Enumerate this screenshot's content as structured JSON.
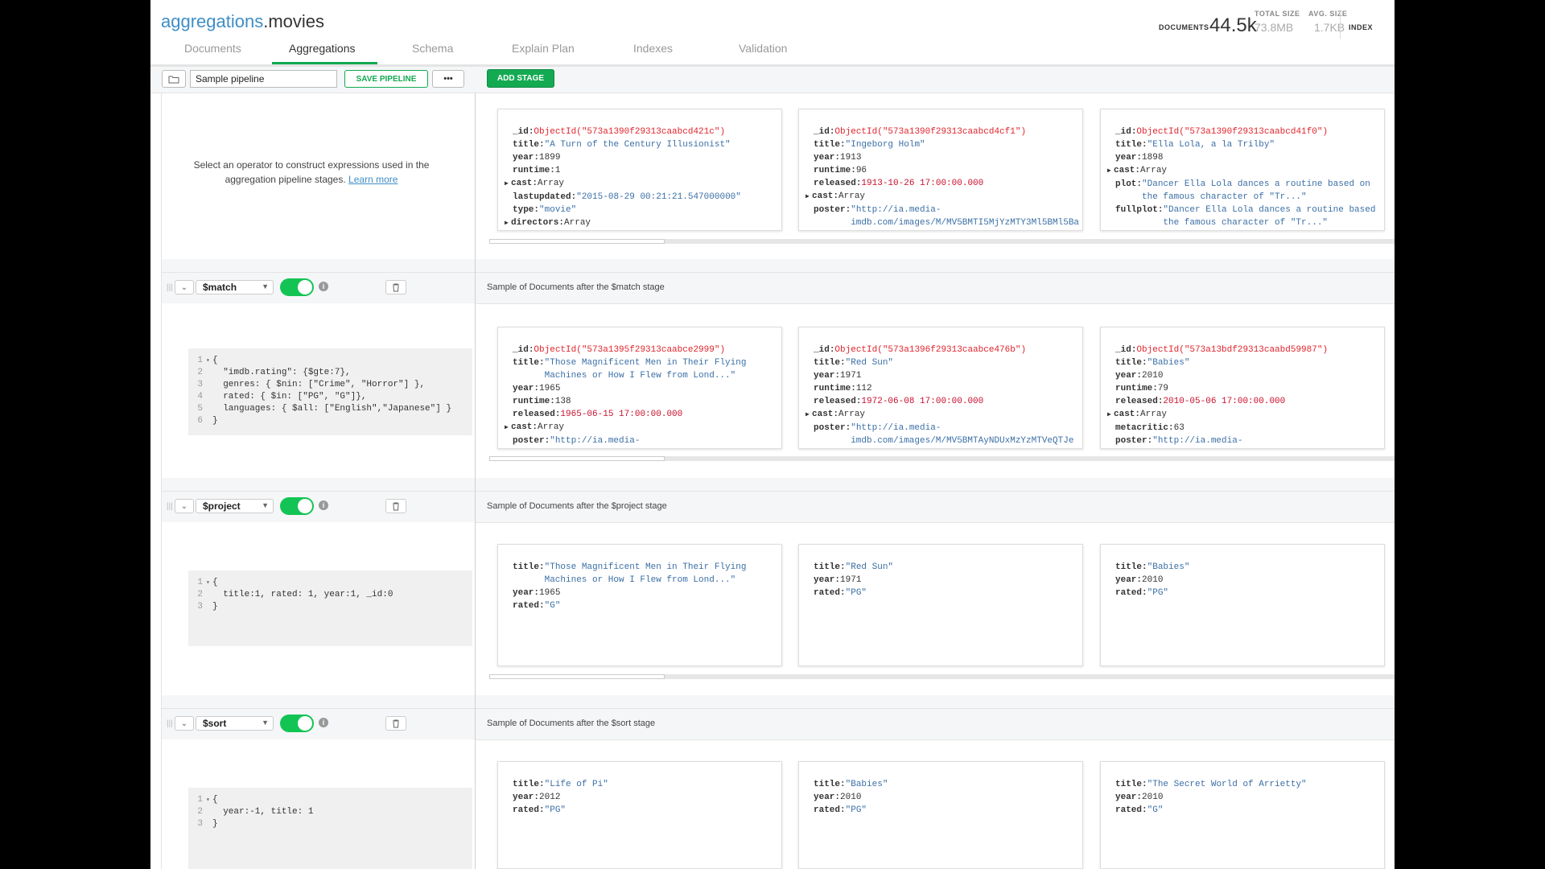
{
  "header": {
    "db": "aggregations",
    "collection": ".movies",
    "documents_label": "DOCUMENTS",
    "documents_value": "44.5k",
    "total_size_label": "TOTAL SIZE",
    "total_size_value": "73.8MB",
    "avg_size_label": "AVG. SIZE",
    "avg_size_value": "1.7KB",
    "indexes_label": "INDEX"
  },
  "tabs": [
    "Documents",
    "Aggregations",
    "Schema",
    "Explain Plan",
    "Indexes",
    "Validation"
  ],
  "toolbar": {
    "pipeline_name": "Sample pipeline",
    "save_label": "SAVE PIPELINE",
    "more_label": "•••",
    "add_stage_label": "ADD STAGE"
  },
  "input_panel": {
    "help_line1": "Select an operator to construct expressions used in the",
    "help_line2": "aggregation pipeline stages.",
    "learn_more": "Learn more"
  },
  "stages": [
    {
      "operator": "$match",
      "sample_label": "Sample of Documents after the $match stage",
      "code": [
        {
          "n": "1",
          "fold": "▾",
          "text": "{"
        },
        {
          "n": "2",
          "fold": "",
          "text": "  \"imdb.rating\": {$gte:7},"
        },
        {
          "n": "3",
          "fold": "",
          "text": "  genres: { $nin: [\"Crime\", \"Horror\"] },"
        },
        {
          "n": "4",
          "fold": "",
          "text": "  rated: { $in: [\"PG\", \"G\"]},"
        },
        {
          "n": "5",
          "fold": "",
          "text": "  languages: { $all: [\"English\",\"Japanese\"] }"
        },
        {
          "n": "6",
          "fold": "",
          "text": "}"
        }
      ]
    },
    {
      "operator": "$project",
      "sample_label": "Sample of Documents after the $project stage",
      "code": [
        {
          "n": "1",
          "fold": "▾",
          "text": "{"
        },
        {
          "n": "2",
          "fold": "",
          "text": "  title:1, rated: 1, year:1, _id:0"
        },
        {
          "n": "3",
          "fold": "",
          "text": "}"
        }
      ]
    },
    {
      "operator": "$sort",
      "sample_label": "Sample of Documents after the $sort stage",
      "code": [
        {
          "n": "1",
          "fold": "▾",
          "text": "{"
        },
        {
          "n": "2",
          "fold": "",
          "text": "  year:-1, title: 1"
        },
        {
          "n": "3",
          "fold": "",
          "text": "}"
        }
      ]
    }
  ],
  "document_rows": [
    [
      [
        {
          "k": "_id",
          "v": "ObjectId(\"573a1390f29313caabcd421c\")",
          "t": "oid"
        },
        {
          "k": "title",
          "v": "\"A Turn of the Century Illusionist\"",
          "t": "str"
        },
        {
          "k": "year",
          "v": "1899",
          "t": "num"
        },
        {
          "k": "runtime",
          "v": "1",
          "t": "num"
        },
        {
          "k": "cast",
          "v": "Array",
          "t": "num",
          "arrow": true
        },
        {
          "k": "lastupdated",
          "v": "\"2015-08-29 00:21:21.547000000\"",
          "t": "str"
        },
        {
          "k": "type",
          "v": "\"movie\"",
          "t": "str"
        },
        {
          "k": "directors",
          "v": "Array",
          "t": "num",
          "arrow": true
        }
      ],
      [
        {
          "k": "_id",
          "v": "ObjectId(\"573a1390f29313caabcd4cf1\")",
          "t": "oid"
        },
        {
          "k": "title",
          "v": "\"Ingeborg Holm\"",
          "t": "str"
        },
        {
          "k": "year",
          "v": "1913",
          "t": "num"
        },
        {
          "k": "runtime",
          "v": "96",
          "t": "num"
        },
        {
          "k": "released",
          "v": "1913-10-26 17:00:00.000",
          "t": "date"
        },
        {
          "k": "cast",
          "v": "Array",
          "t": "num",
          "arrow": true
        },
        {
          "k": "poster",
          "v": "\"http://ia.media-",
          "t": "str",
          "cont": "imdb.com/images/M/MV5BMTI5MjYzMTY3Ml5BMl5Ba"
        }
      ],
      [
        {
          "k": "_id",
          "v": "ObjectId(\"573a1390f29313caabcd41f0\")",
          "t": "oid"
        },
        {
          "k": "title",
          "v": "\"Ella Lola, a la Trilby\"",
          "t": "str"
        },
        {
          "k": "year",
          "v": "1898",
          "t": "num"
        },
        {
          "k": "cast",
          "v": "Array",
          "t": "num",
          "arrow": true
        },
        {
          "k": "plot",
          "v": "\"Dancer Ella Lola dances a routine based on",
          "t": "str",
          "cont": "the famous character of \"Tr...\""
        },
        {
          "k": "fullplot",
          "v": "\"Dancer Ella Lola dances a routine based",
          "t": "str",
          "cont": "the famous character of \"Tr...\""
        }
      ]
    ],
    [
      [
        {
          "k": "_id",
          "v": "ObjectId(\"573a1395f29313caabce2999\")",
          "t": "oid"
        },
        {
          "k": "title",
          "v": "\"Those Magnificent Men in Their Flying",
          "t": "str",
          "cont": "Machines or How I Flew from Lond...\""
        },
        {
          "k": "year",
          "v": "1965",
          "t": "num"
        },
        {
          "k": "runtime",
          "v": "138",
          "t": "num"
        },
        {
          "k": "released",
          "v": "1965-06-15 17:00:00.000",
          "t": "date"
        },
        {
          "k": "cast",
          "v": "Array",
          "t": "num",
          "arrow": true
        },
        {
          "k": "poster",
          "v": "\"http://ia.media-",
          "t": "str"
        }
      ],
      [
        {
          "k": "_id",
          "v": "ObjectId(\"573a1396f29313caabce476b\")",
          "t": "oid"
        },
        {
          "k": "title",
          "v": "\"Red Sun\"",
          "t": "str"
        },
        {
          "k": "year",
          "v": "1971",
          "t": "num"
        },
        {
          "k": "runtime",
          "v": "112",
          "t": "num"
        },
        {
          "k": "released",
          "v": "1972-06-08 17:00:00.000",
          "t": "date"
        },
        {
          "k": "cast",
          "v": "Array",
          "t": "num",
          "arrow": true
        },
        {
          "k": "poster",
          "v": "\"http://ia.media-",
          "t": "str",
          "cont": "imdb.com/images/M/MV5BMTAyNDUxMzYzMTVeQTJe"
        }
      ],
      [
        {
          "k": "_id",
          "v": "ObjectId(\"573a13bdf29313caabd59987\")",
          "t": "oid"
        },
        {
          "k": "title",
          "v": "\"Babies\"",
          "t": "str"
        },
        {
          "k": "year",
          "v": "2010",
          "t": "num"
        },
        {
          "k": "runtime",
          "v": "79",
          "t": "num"
        },
        {
          "k": "released",
          "v": "2010-05-06 17:00:00.000",
          "t": "date"
        },
        {
          "k": "cast",
          "v": "Array",
          "t": "num",
          "arrow": true
        },
        {
          "k": "metacritic",
          "v": "63",
          "t": "num"
        },
        {
          "k": "poster",
          "v": "\"http://ia.media-",
          "t": "str"
        }
      ]
    ],
    [
      [
        {
          "k": "title",
          "v": "\"Those Magnificent Men in Their Flying",
          "t": "str",
          "cont": "Machines or How I Flew from Lond...\""
        },
        {
          "k": "year",
          "v": "1965",
          "t": "num"
        },
        {
          "k": "rated",
          "v": "\"G\"",
          "t": "str"
        }
      ],
      [
        {
          "k": "title",
          "v": "\"Red Sun\"",
          "t": "str"
        },
        {
          "k": "year",
          "v": "1971",
          "t": "num"
        },
        {
          "k": "rated",
          "v": "\"PG\"",
          "t": "str"
        }
      ],
      [
        {
          "k": "title",
          "v": "\"Babies\"",
          "t": "str"
        },
        {
          "k": "year",
          "v": "2010",
          "t": "num"
        },
        {
          "k": "rated",
          "v": "\"PG\"",
          "t": "str"
        }
      ]
    ],
    [
      [
        {
          "k": "title",
          "v": "\"Life of Pi\"",
          "t": "str"
        },
        {
          "k": "year",
          "v": "2012",
          "t": "num"
        },
        {
          "k": "rated",
          "v": "\"PG\"",
          "t": "str"
        }
      ],
      [
        {
          "k": "title",
          "v": "\"Babies\"",
          "t": "str"
        },
        {
          "k": "year",
          "v": "2010",
          "t": "num"
        },
        {
          "k": "rated",
          "v": "\"PG\"",
          "t": "str"
        }
      ],
      [
        {
          "k": "title",
          "v": "\"The Secret World of Arrietty\"",
          "t": "str"
        },
        {
          "k": "year",
          "v": "2010",
          "t": "num"
        },
        {
          "k": "rated",
          "v": "\"G\"",
          "t": "str"
        }
      ]
    ]
  ],
  "colors": {
    "accent": "#13aa52",
    "link": "#3e8ec6",
    "oid": "#e0242c",
    "string": "#3b6fa6"
  },
  "icons": {
    "folder": "folder-icon",
    "grip": "drag-handle-icon",
    "trash": "trash-icon",
    "info": "info-icon"
  }
}
